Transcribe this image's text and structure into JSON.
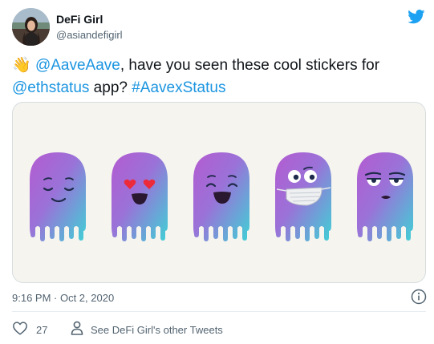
{
  "author": {
    "name": "DeFi Girl",
    "handle": "@asiandefigirl"
  },
  "tweet": {
    "emoji": "👋",
    "mention_1": "@AaveAave",
    "text_part_1": ", have you seen these cool stickers for ",
    "mention_2": "@ethstatus",
    "text_part_2": " app? ",
    "hashtag": "#AavexStatus"
  },
  "media": {
    "stickers": [
      "smiling-ghost",
      "heart-eyes-ghost",
      "laughing-ghost",
      "masked-ghost",
      "unamused-ghost"
    ]
  },
  "footer": {
    "timestamp": "9:16 PM · Oct 2, 2020",
    "like_count": "27",
    "other_tweets_label": "See DeFi Girl's other Tweets"
  },
  "colors": {
    "link": "#1b95e0",
    "twitter_blue": "#1da1f2",
    "muted_text": "#536471",
    "heart_eye": "#ec2a3a"
  }
}
